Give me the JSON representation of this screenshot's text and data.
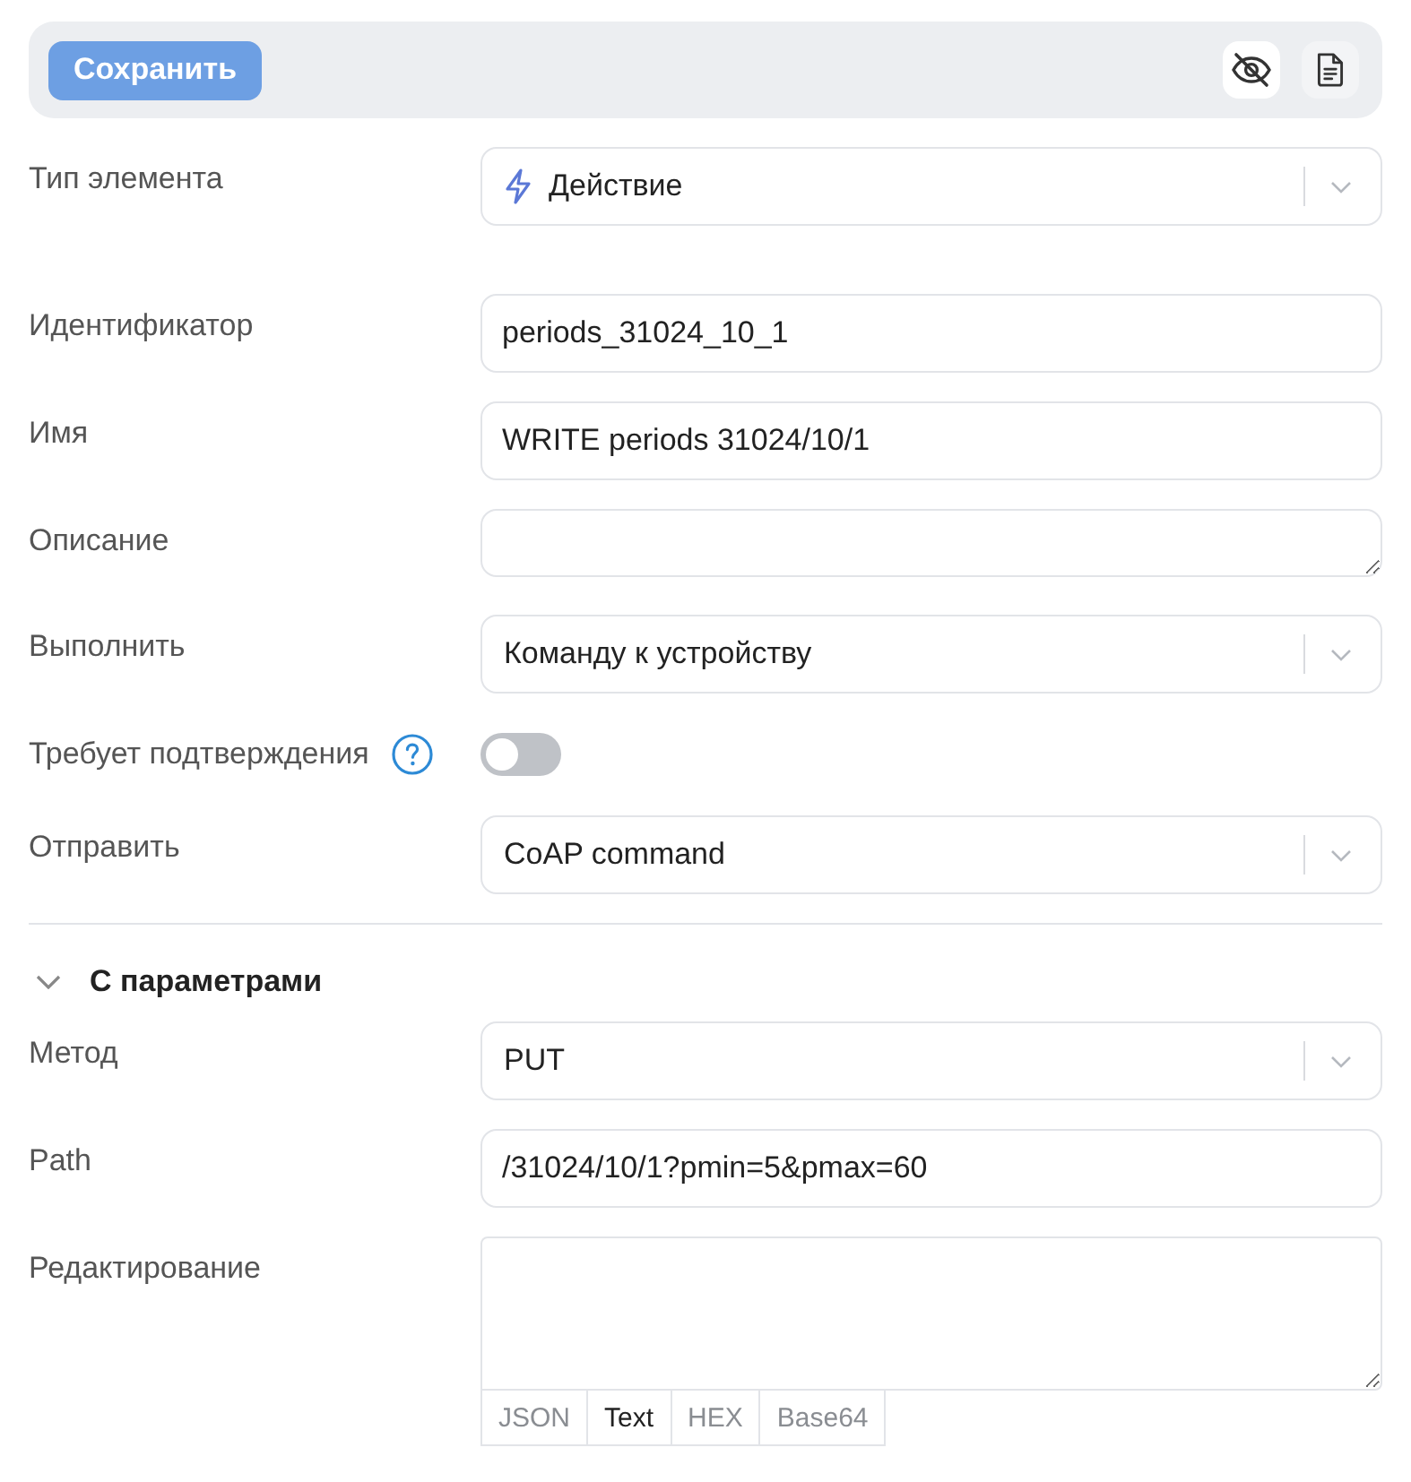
{
  "toolbar": {
    "save_button": {
      "label": "Сохранить",
      "disabled": true
    },
    "icon_buttons": [
      {
        "kind": "visibility",
        "selected": true
      },
      {
        "kind": "document",
        "selected": false
      }
    ]
  },
  "element_type": {
    "label": "Тип элемента",
    "value": "Действие",
    "icon": true
  },
  "fields": [
    {
      "kind": "input",
      "label": "Идентификатор",
      "value": "periods_31024_10_1"
    },
    {
      "kind": "input",
      "label": "Имя",
      "value": "WRITE periods 31024/10/1"
    },
    {
      "kind": "textarea",
      "label": "Описание"
    },
    {
      "kind": "select",
      "label": "Выполнить",
      "value": "Команду к устройству"
    },
    {
      "kind": "toggle",
      "label": "Требует подтверждения",
      "help": true,
      "on": false
    },
    {
      "kind": "select",
      "label": "Отправить",
      "value": "CoAP command"
    }
  ],
  "section": {
    "title": "С параметрами",
    "expanded": true,
    "fields": [
      {
        "kind": "select",
        "label": "Метод",
        "value": "PUT"
      },
      {
        "kind": "input",
        "label": "Path",
        "value": "/31024/10/1?pmin=5&pmax=60"
      },
      {
        "kind": "editor",
        "label": "Редактирование",
        "formats": [
          {
            "label": "JSON",
            "selected": false
          },
          {
            "label": "Text",
            "selected": true
          },
          {
            "label": "HEX",
            "selected": false
          },
          {
            "label": "Base64",
            "selected": false
          }
        ]
      }
    ]
  }
}
